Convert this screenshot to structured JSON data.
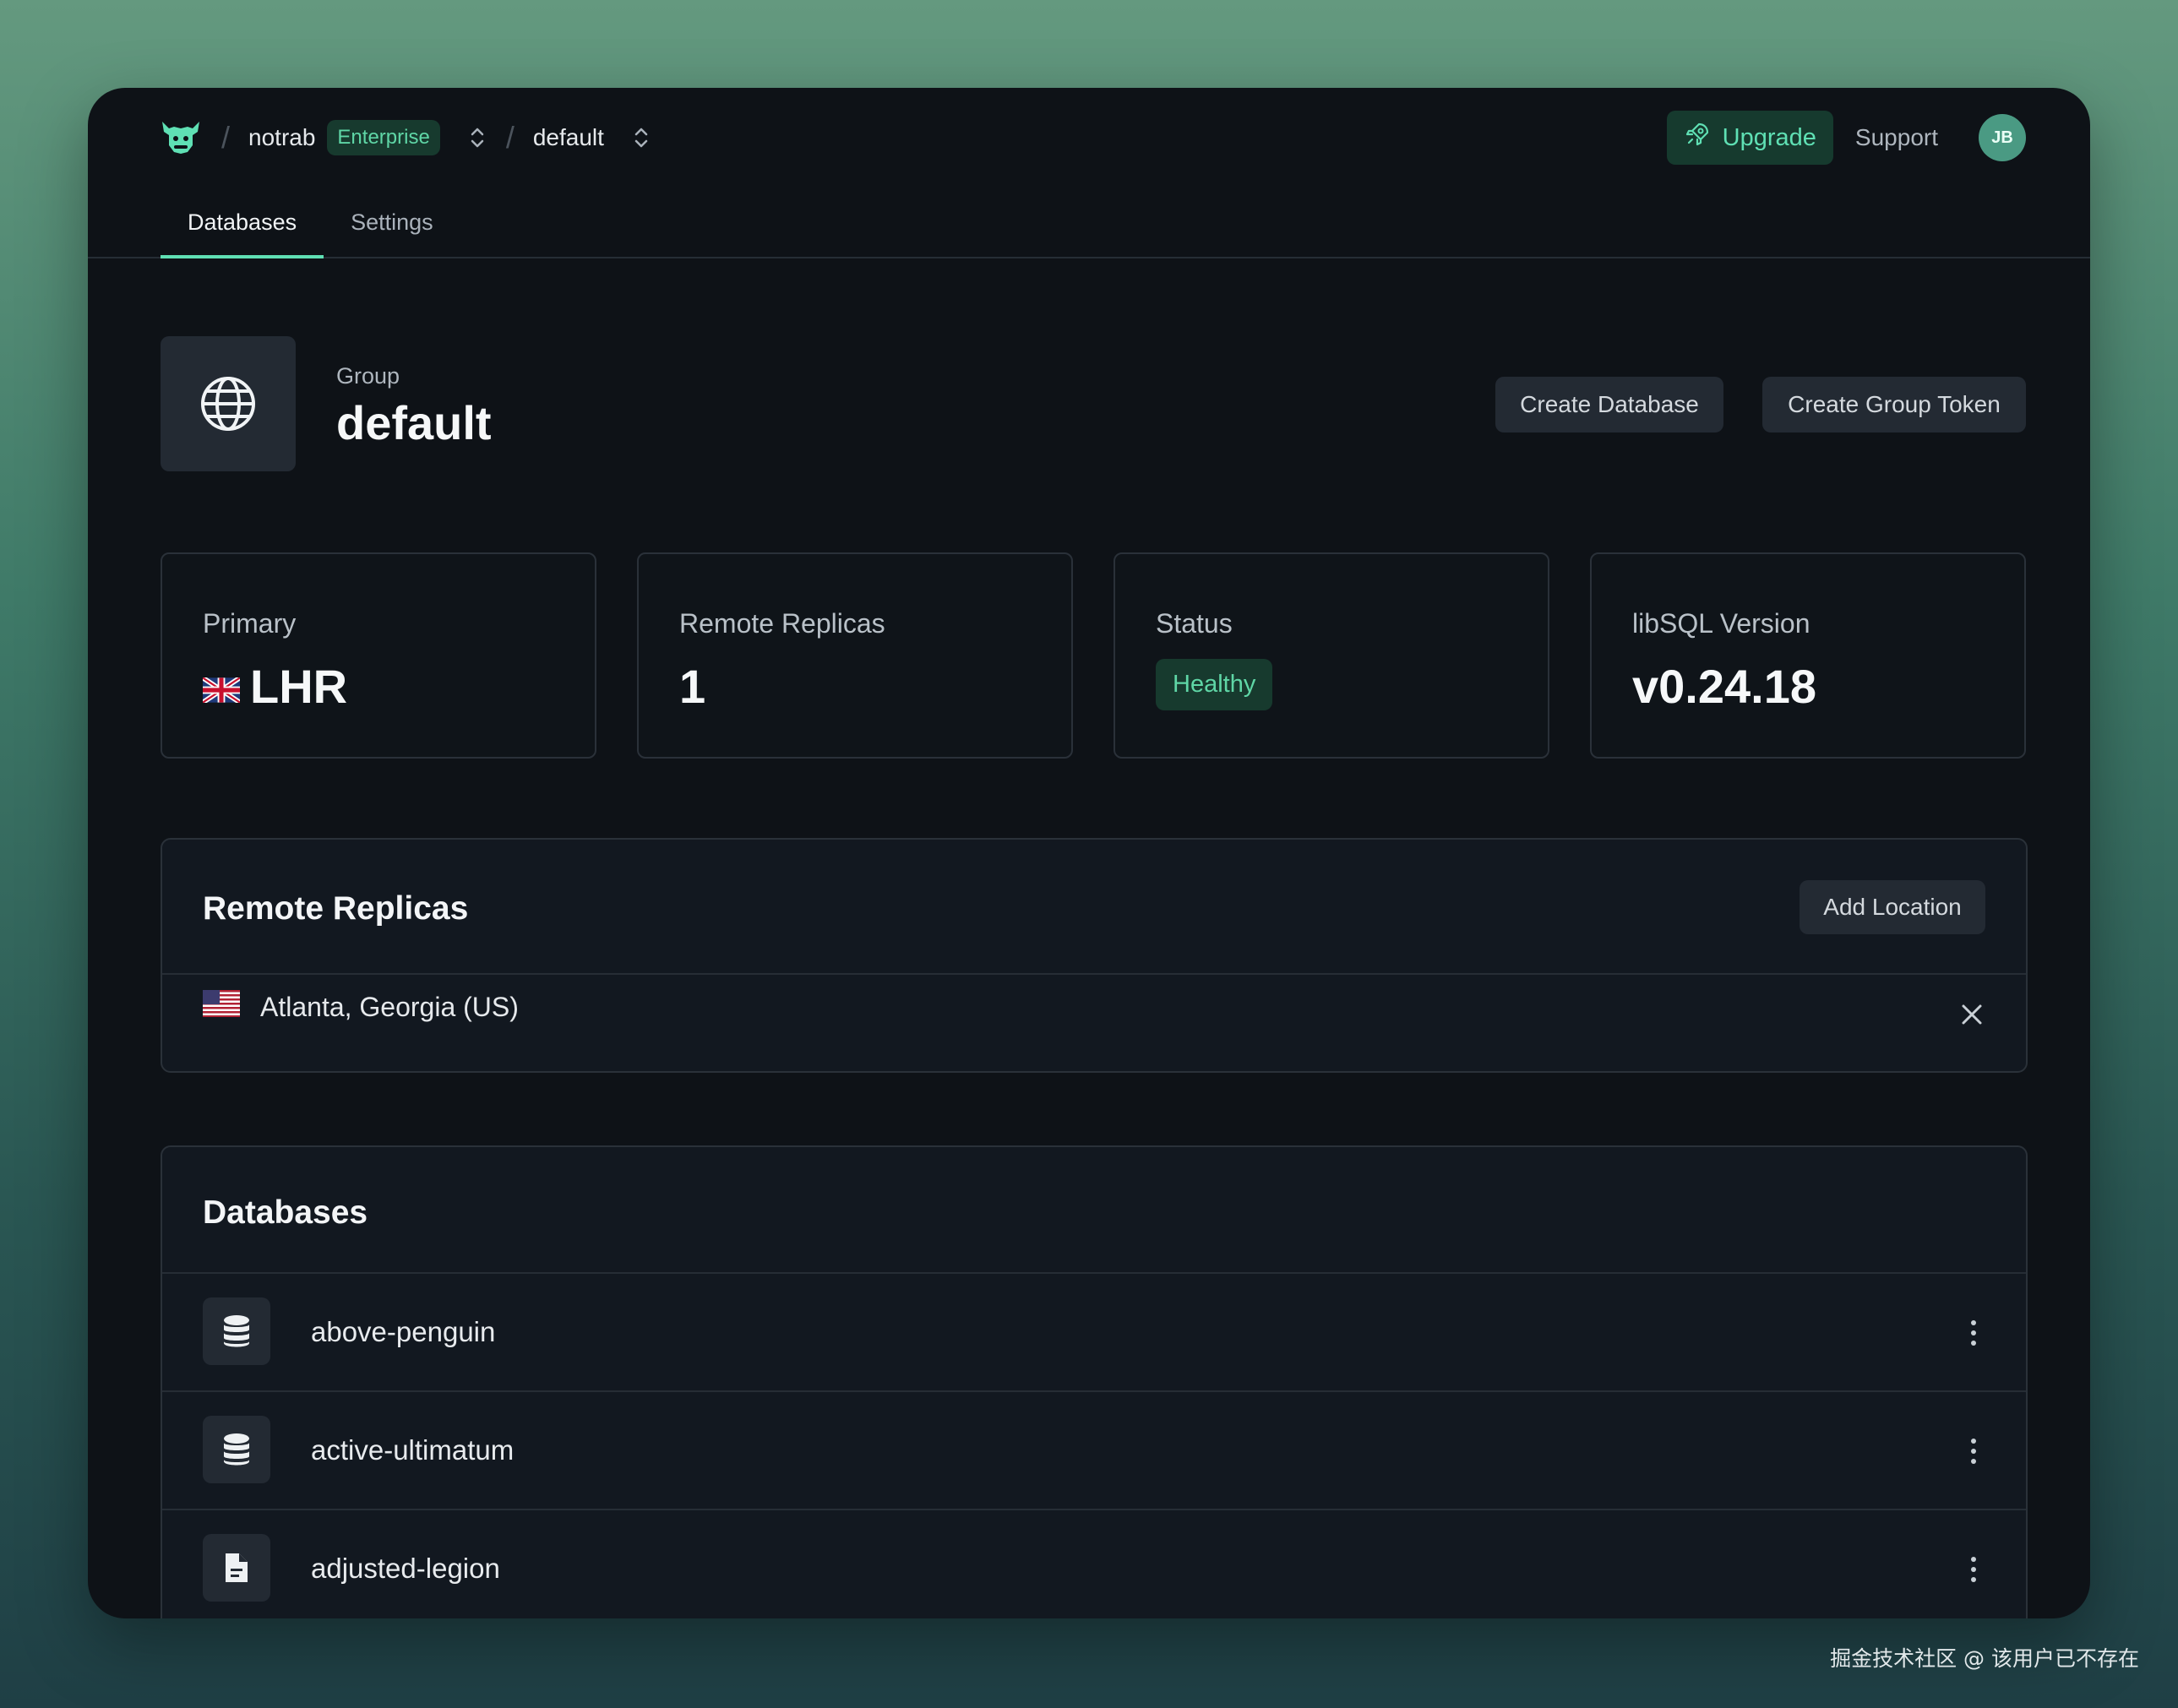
{
  "breadcrumb": {
    "org": "notrab",
    "plan_badge": "Enterprise",
    "group": "default"
  },
  "header_actions": {
    "upgrade_label": "Upgrade",
    "support_label": "Support",
    "avatar_initials": "JB"
  },
  "tabs": [
    {
      "label": "Databases",
      "active": true
    },
    {
      "label": "Settings",
      "active": false
    }
  ],
  "group": {
    "eyebrow": "Group",
    "name": "default",
    "create_database_label": "Create Database",
    "create_token_label": "Create Group Token"
  },
  "stats": {
    "primary": {
      "label": "Primary",
      "value": "LHR",
      "flag": "uk-flag"
    },
    "replicas": {
      "label": "Remote Replicas",
      "value": "1"
    },
    "status": {
      "label": "Status",
      "value": "Healthy"
    },
    "version": {
      "label": "libSQL Version",
      "value": "v0.24.18"
    }
  },
  "remote_replicas": {
    "title": "Remote Replicas",
    "add_label": "Add Location",
    "items": [
      {
        "name": "Atlanta, Georgia (US)",
        "flag": "us-flag"
      }
    ]
  },
  "databases": {
    "title": "Databases",
    "items": [
      {
        "name": "above-penguin",
        "icon": "database-icon"
      },
      {
        "name": "active-ultimatum",
        "icon": "database-icon"
      },
      {
        "name": "adjusted-legion",
        "icon": "file-icon"
      }
    ]
  },
  "watermark": "掘金技术社区 @ 该用户已不存在",
  "colors": {
    "accent": "#5fe0b4",
    "window_bg": "#0e1217",
    "badge_bg": "#173a2e"
  }
}
